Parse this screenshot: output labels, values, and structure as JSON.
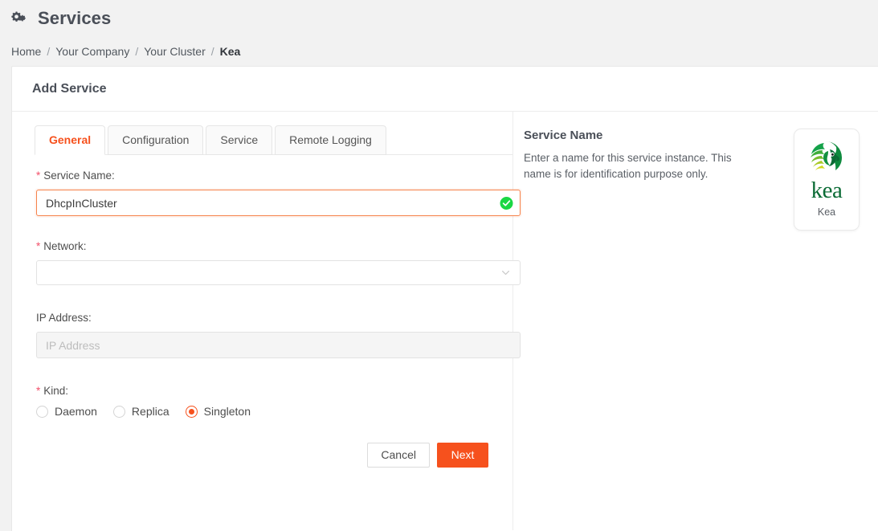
{
  "page": {
    "title": "Services",
    "title_icon": "cogs-icon"
  },
  "breadcrumb": {
    "items": [
      {
        "label": "Home",
        "current": false
      },
      {
        "label": "Your Company",
        "current": false
      },
      {
        "label": "Your Cluster",
        "current": false
      },
      {
        "label": "Kea",
        "current": true
      }
    ],
    "separator": "/"
  },
  "card": {
    "heading": "Add Service"
  },
  "tabs": [
    {
      "label": "General",
      "active": true
    },
    {
      "label": "Configuration",
      "active": false
    },
    {
      "label": "Service",
      "active": false
    },
    {
      "label": "Remote Logging",
      "active": false
    }
  ],
  "form": {
    "service_name": {
      "label": "Service Name",
      "required_mark": "*",
      "colon": ":",
      "value": "DhcpInCluster",
      "placeholder": "",
      "valid_icon": "check-circle-icon"
    },
    "network": {
      "label": "Network",
      "required_mark": "*",
      "colon": ":",
      "value": "",
      "chevron_icon": "chevron-down-icon"
    },
    "ip_address": {
      "label": "IP Address",
      "required_mark": "",
      "colon": ":",
      "value": "",
      "placeholder": "IP Address",
      "disabled": true
    },
    "kind": {
      "label": "Kind",
      "required_mark": "*",
      "colon": ":",
      "options": [
        {
          "label": "Daemon",
          "selected": false
        },
        {
          "label": "Replica",
          "selected": false
        },
        {
          "label": "Singleton",
          "selected": true
        }
      ]
    }
  },
  "buttons": {
    "cancel": "Cancel",
    "next": "Next"
  },
  "help": {
    "title": "Service Name",
    "body": "Enter a name for this service instance. This name is for identification purpose only."
  },
  "logo": {
    "wordmark": "kea",
    "caption": "Kea",
    "icon": "kea-parrot-logo"
  },
  "colors": {
    "accent_orange": "#f6511d",
    "valid_green": "#1ad744",
    "required_red": "#f2506a",
    "kea_green": "#0b6b35",
    "page_bg": "#f2f2f2"
  }
}
